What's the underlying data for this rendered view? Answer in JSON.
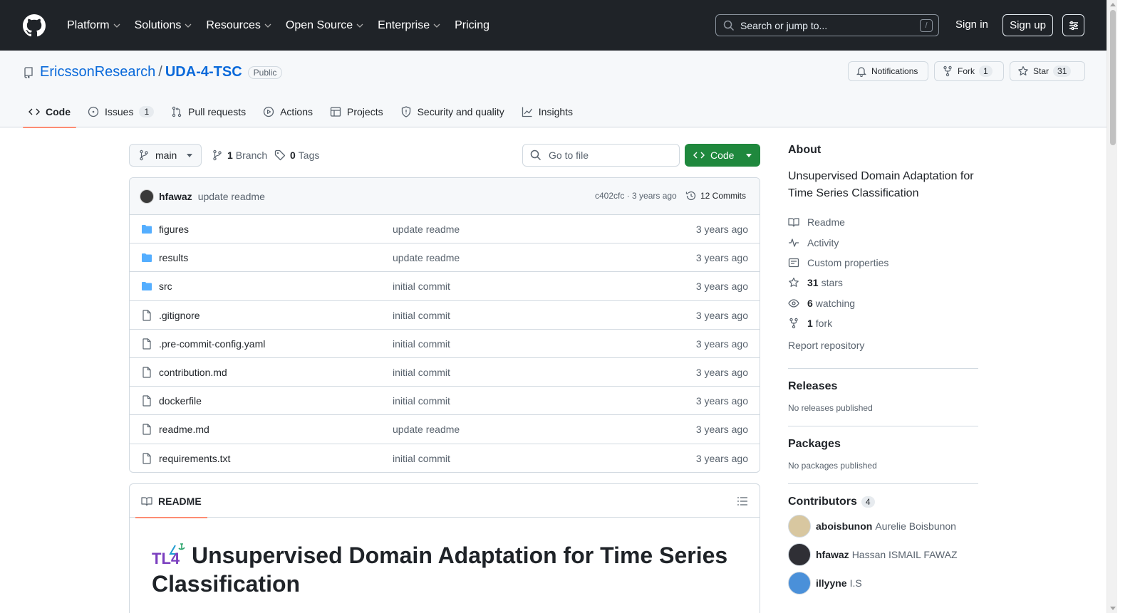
{
  "header": {
    "nav": [
      "Platform",
      "Solutions",
      "Resources",
      "Open Source",
      "Enterprise",
      "Pricing"
    ],
    "search_placeholder": "Search or jump to...",
    "search_shortcut": "/",
    "signin": "Sign in",
    "signup": "Sign up"
  },
  "repo": {
    "owner": "EricssonResearch",
    "separator": "/",
    "name": "UDA-4-TSC",
    "visibility": "Public",
    "notifications": "Notifications",
    "fork_label": "Fork",
    "fork_count": "1",
    "star_label": "Star",
    "star_count": "31"
  },
  "tabs": [
    {
      "label": "Code",
      "active": true
    },
    {
      "label": "Issues",
      "count": "1"
    },
    {
      "label": "Pull requests"
    },
    {
      "label": "Actions"
    },
    {
      "label": "Projects"
    },
    {
      "label": "Security and quality"
    },
    {
      "label": "Insights"
    }
  ],
  "toolbar": {
    "branch": "main",
    "branch_count": "1",
    "branch_label": "Branch",
    "tag_count": "0",
    "tag_label": "Tags",
    "goto_placeholder": "Go to file",
    "code_button": "Code"
  },
  "latest_commit": {
    "author": "hfawaz",
    "message": "update readme",
    "sha_age": "c402cfc · 3 years ago",
    "commits": "12 Commits"
  },
  "files": [
    {
      "name": "figures",
      "type": "dir",
      "message": "update readme",
      "age": "3 years ago"
    },
    {
      "name": "results",
      "type": "dir",
      "message": "update readme",
      "age": "3 years ago"
    },
    {
      "name": "src",
      "type": "dir",
      "message": "initial commit",
      "age": "3 years ago"
    },
    {
      "name": ".gitignore",
      "type": "file",
      "message": "initial commit",
      "age": "3 years ago"
    },
    {
      "name": ".pre-commit-config.yaml",
      "type": "file",
      "message": "initial commit",
      "age": "3 years ago"
    },
    {
      "name": "contribution.md",
      "type": "file",
      "message": "initial commit",
      "age": "3 years ago"
    },
    {
      "name": "dockerfile",
      "type": "file",
      "message": "initial commit",
      "age": "3 years ago"
    },
    {
      "name": "readme.md",
      "type": "file",
      "message": "update readme",
      "age": "3 years ago"
    },
    {
      "name": "requirements.txt",
      "type": "file",
      "message": "initial commit",
      "age": "3 years ago"
    }
  ],
  "readme": {
    "tab": "README",
    "logo_text": "TL4",
    "title": "Unsupervised Domain Adaptation for Time Series Classification"
  },
  "about": {
    "heading": "About",
    "description": "Unsupervised Domain Adaptation for Time Series Classification",
    "readme": "Readme",
    "activity": "Activity",
    "custom_properties": "Custom properties",
    "stars_count": "31",
    "stars_label": "stars",
    "watching_count": "6",
    "watching_label": "watching",
    "fork_count": "1",
    "fork_label": "fork",
    "report": "Report repository"
  },
  "releases": {
    "heading": "Releases",
    "empty": "No releases published"
  },
  "packages": {
    "heading": "Packages",
    "empty": "No packages published"
  },
  "contributors": {
    "heading": "Contributors",
    "count": "4",
    "list": [
      {
        "login": "aboisbunon",
        "name": "Aurelie Boisbunon"
      },
      {
        "login": "hfawaz",
        "name": "Hassan ISMAIL FAWAZ"
      },
      {
        "login": "illyyne",
        "name": "I.S"
      }
    ]
  },
  "colors": {
    "header_bg": "#1f2328",
    "link": "#0969da",
    "primary_button": "#1f883d",
    "active_tab_underline": "#fd8c73",
    "folder_icon": "#54aeff"
  }
}
